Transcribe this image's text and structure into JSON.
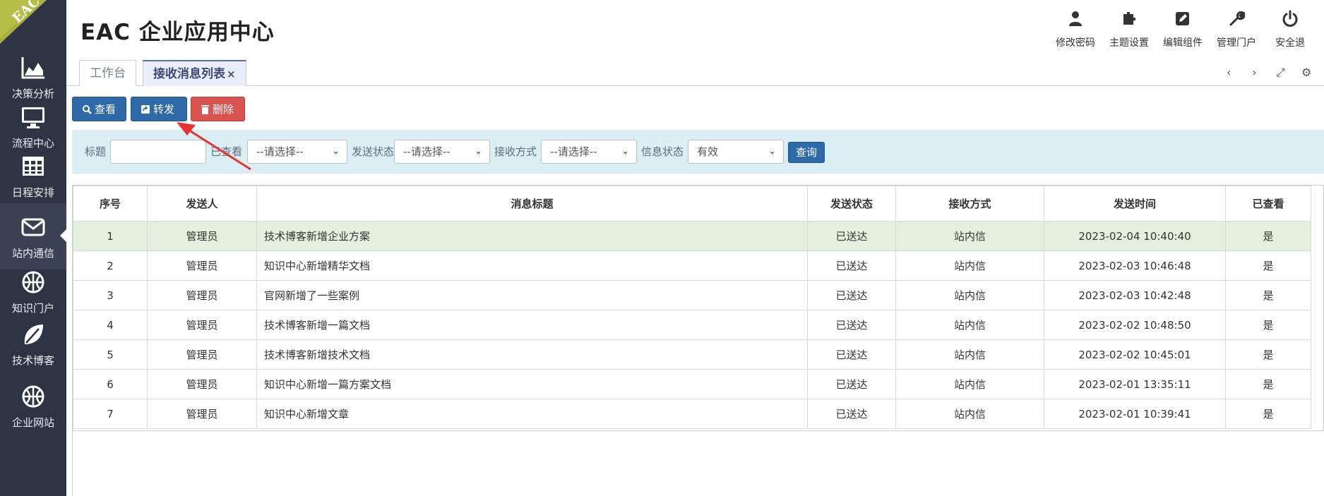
{
  "app": {
    "title": "EAC 企业应用中心",
    "logo_text": "EAC"
  },
  "sidebar": {
    "items": [
      {
        "label": "决策分析",
        "icon": "area-chart-icon"
      },
      {
        "label": "流程中心",
        "icon": "monitor-icon"
      },
      {
        "label": "日程安排",
        "icon": "calendar-grid-icon"
      },
      {
        "label": "站内通信",
        "icon": "envelope-icon",
        "active": true
      },
      {
        "label": "知识门户",
        "icon": "basketball-icon"
      },
      {
        "label": "技术博客",
        "icon": "leaf-icon"
      },
      {
        "label": "企业网站",
        "icon": "basketball-icon"
      }
    ]
  },
  "header_tools": [
    {
      "label": "修改密码",
      "icon": "user-icon"
    },
    {
      "label": "主题设置",
      "icon": "puzzle-icon"
    },
    {
      "label": "编辑组件",
      "icon": "edit-icon"
    },
    {
      "label": "管理门户",
      "icon": "wrench-icon"
    },
    {
      "label": "安全退",
      "icon": "power-icon"
    }
  ],
  "tabs": [
    {
      "label": "工作台",
      "active": false
    },
    {
      "label": "接收消息列表",
      "close": "×",
      "active": true
    }
  ],
  "tab_controls": [
    "‹",
    "›",
    "⤢",
    "⚙"
  ],
  "toolbar": {
    "view_label": "查看",
    "forward_label": "转发",
    "delete_label": "删除"
  },
  "filter": {
    "title_label": "标题",
    "title_value": "",
    "viewed_label": "已查看",
    "viewed_value": "--请选择--",
    "send_status_label": "发送状态",
    "send_status_value": "--请选择--",
    "receive_mode_label": "接收方式",
    "receive_mode_value": "--请选择--",
    "info_status_label": "信息状态",
    "info_status_value": "有效",
    "query_label": "查询"
  },
  "table": {
    "columns": [
      "序号",
      "发送人",
      "消息标题",
      "发送状态",
      "接收方式",
      "发送时间",
      "已查看"
    ],
    "rows": [
      [
        "1",
        "管理员",
        "技术博客新增企业方案",
        "已送达",
        "站内信",
        "2023-02-04 10:40:40",
        "是"
      ],
      [
        "2",
        "管理员",
        "知识中心新增精华文档",
        "已送达",
        "站内信",
        "2023-02-03 10:46:48",
        "是"
      ],
      [
        "3",
        "管理员",
        "官网新增了一些案例",
        "已送达",
        "站内信",
        "2023-02-03 10:42:48",
        "是"
      ],
      [
        "4",
        "管理员",
        "技术博客新增一篇文档",
        "已送达",
        "站内信",
        "2023-02-02 10:48:50",
        "是"
      ],
      [
        "5",
        "管理员",
        "技术博客新增技术文档",
        "已送达",
        "站内信",
        "2023-02-02 10:45:01",
        "是"
      ],
      [
        "6",
        "管理员",
        "知识中心新增一篇方案文档",
        "已送达",
        "站内信",
        "2023-02-01 13:35:11",
        "是"
      ],
      [
        "7",
        "管理员",
        "知识中心新增文章",
        "已送达",
        "站内信",
        "2023-02-01 10:39:41",
        "是"
      ]
    ],
    "highlighted_row": 0
  },
  "colors": {
    "sidebar": "#2e3443",
    "primary": "#2e6aa9",
    "danger": "#d9534f",
    "filter_bg": "#dbeef4",
    "row_highlight": "#e4f0dd",
    "annotation": "#e8322f",
    "logo_bg": "#a9b33a"
  }
}
